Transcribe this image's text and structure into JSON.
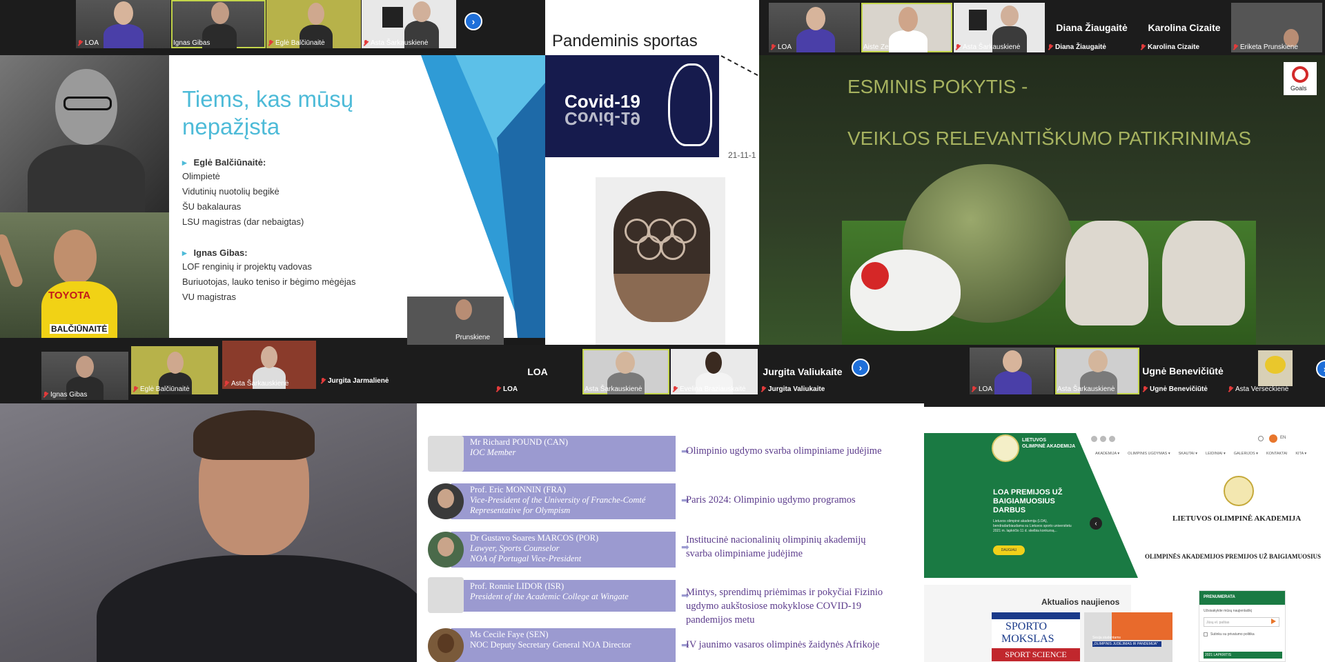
{
  "top_left_strip": {
    "tiles": [
      {
        "name": "LOA"
      },
      {
        "name": "Ignas Gibas"
      },
      {
        "name": "Eglė Balčiūnaitė"
      },
      {
        "name": "Asta Šarkauskienė"
      }
    ]
  },
  "slide_intro": {
    "title": "Tiems, kas mūsų nepažįsta",
    "person1": "Eglė Balčiūnaitė:",
    "person1_lines": [
      "Olimpietė",
      "Vidutinių nuotolių begikė",
      "ŠU bakalauras",
      "LSU magistras (dar nebaigtas)"
    ],
    "person2": "Ignas Gibas:",
    "person2_lines": [
      "LOF renginių ir projektų vadovas",
      "Buriuotojas, lauko teniso ir bėgimo mėgėjas",
      "VU magistras"
    ],
    "shirt_text": "TOYOTA",
    "bib_text": "BALČIŪNAITĖ"
  },
  "slide_pandemic": {
    "title": "Pandeminis sportas",
    "covid_text": "Covid-19",
    "date": "21-11-1"
  },
  "top_right_strip": {
    "tiles": [
      {
        "name": "LOA"
      },
      {
        "name": "Aiste Zemaityte"
      },
      {
        "name": "Asta Šarkauskienė"
      },
      {
        "name": "Diana Žiaugaitė",
        "big": "Diana Žiaugaitė"
      },
      {
        "name": "Karolina Cizaite",
        "big": "Karolina Cizaite"
      },
      {
        "name": "Eriketa Prunskiene"
      }
    ]
  },
  "slide_green": {
    "line1": "ESMINIS POKYTIS -",
    "line2": "VEIKLOS RELEVANTIŠKUMO PATIKRINIMAS",
    "goals_label": "Goals"
  },
  "middle_strip": {
    "tiles": [
      {
        "name": "Ignas Gibas"
      },
      {
        "name": "Eglė Balčiūnaitė"
      },
      {
        "name": "Asta Šarkauskienė"
      },
      {
        "name": "Jurgita Jarmalienė"
      },
      {
        "name": "Prunskiene"
      }
    ]
  },
  "center_strip": {
    "tiles": [
      {
        "name": "LOA",
        "big": "LOA"
      },
      {
        "name": "Asta Šarkauskienė"
      },
      {
        "name": "Evelina Braziauskaitė"
      },
      {
        "name": "Jurgita Valiukaite",
        "big": "Jurgita Valiukaite"
      }
    ]
  },
  "right_strip": {
    "tiles": [
      {
        "name": "LOA"
      },
      {
        "name": "Asta Šarkauskienė"
      },
      {
        "name": "Ugnė Benevičiūtė",
        "big": "Ugnė Benevičiūtė"
      },
      {
        "name": "Asta Verseckienė"
      }
    ]
  },
  "speakers_slide": {
    "rows": [
      {
        "name": "Mr Richard POUND (CAN)",
        "role": "IOC Member",
        "topic": [
          "Olimpinio ugdymo svarba olimpiniame judėjime"
        ]
      },
      {
        "name": "Prof. Eric MONNIN (FRA)",
        "role": "Vice-President of the University of Franche-Comté",
        "role2": "Representative for Olympism",
        "topic": [
          "Paris 2024: Olimpinio ugdymo programos"
        ]
      },
      {
        "name": "Dr Gustavo Soares MARCOS (POR)",
        "role": "Lawyer, Sports Counselor",
        "role2": "NOA of Portugal Vice-President",
        "topic": [
          "Institucinė nacionalinių olimpinių akademijų",
          "svarba olimpiniame judėjime"
        ]
      },
      {
        "name": "Prof. Ronnie LIDOR (ISR)",
        "role": "President of the Academic College at Wingate",
        "topic": [
          "Mintys, sprendimų priėmimas ir pokyčiai Fizinio",
          "ugdymo aukštosiose mokyklose COVID-19",
          "pandemijos metu"
        ]
      },
      {
        "name": "Ms Cecile Faye (SEN)",
        "role": "NOC Deputy Secretary General NOA Director",
        "topic": [
          "IV jaunimo vasaros olimpinės žaidynės Afrikoje"
        ]
      }
    ]
  },
  "website": {
    "logo_line1": "LIETUVOS",
    "logo_line2": "OLIMPINĖ AKADEMIJA",
    "nav": [
      "AKADEMIJA ▾",
      "OLIMPINIS UGDYMAS ▾",
      "SKAUTAI ▾",
      "LEIDINIAI ▾",
      "GALERIJOS ▾",
      "KONTAKTAI",
      "KITA ▾"
    ],
    "lang": "EN",
    "hero_title": "LOA PREMIJOS UŽ BAIGIAMUOSIUS DARBUS",
    "hero_text": "Lietuvos olimpinė akademija (LOA), bendradarbiaudama su Lietuvos sporto universitetu 2021 m. lapkričio 11 d. skelbia konkursą...",
    "hero_button": "DAUGIAU",
    "hero_right_title": "LIETUVOS OLIMPINĖ AKADEMIJA",
    "hero_right_sub": "OLIMPINĖS AKADEMIJOS PREMIJOS UŽ BAIGIAMUOSIUS",
    "news_title": "Aktualios naujienos",
    "card1_top": "SPORTO",
    "card1_mid": "MOKSLAS",
    "card1_bottom": "SPORT SCIENCE",
    "card2_text": "„OLIMPINIS JUDĖJIMAS IR PANDEMIJA“",
    "card2_pre": "Sesija studentams",
    "sub_title": "PRENUMERATA",
    "sub_text": "Užsisakykite mūsų naujienlaiškį",
    "sub_placeholder": "Jūsų el. paštas",
    "sub_check": "Sutinku su privatumo politika",
    "sub_date": "2021 LAPKRITIS"
  }
}
